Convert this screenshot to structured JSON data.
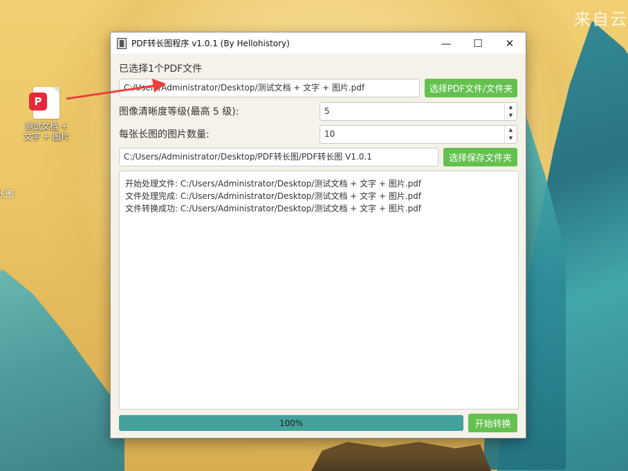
{
  "desktop": {
    "watermark": "来自云",
    "icon_label": "测试文档 +\n文字 + 图片",
    "icon_badge": "P",
    "left_edge_label": "长图"
  },
  "window": {
    "title": "PDF转长图程序 v1.0.1 (By Hellohistory)",
    "controls": {
      "minimize": "—",
      "maximize": "☐",
      "close": "✕"
    },
    "selected_count_label": "已选择1个PDF文件",
    "pdf_path": "C:/Users/Administrator/Desktop/测试文档 + 文字 + 图片.pdf",
    "select_pdf_button": "选择PDF文件/文件夹",
    "clarity_label": "图像清晰度等级(最高 5 级):",
    "clarity_value": "5",
    "images_per_long_label": "每张长图的图片数量:",
    "images_per_long_value": "10",
    "save_path": "C:/Users/Administrator/Desktop/PDF转长图/PDF转长图 V1.0.1",
    "select_save_button": "选择保存文件夹",
    "log_lines": [
      "开始处理文件: C:/Users/Administrator/Desktop/测试文档 + 文字 + 图片.pdf",
      "文件处理完成: C:/Users/Administrator/Desktop/测试文档 + 文字 + 图片.pdf",
      "文件转换成功: C:/Users/Administrator/Desktop/测试文档 + 文字 + 图片.pdf"
    ],
    "progress_text": "100%",
    "progress_value": 100,
    "start_button": "开始转换"
  },
  "colors": {
    "accent_green": "#64c04f",
    "progress_teal": "#45a19c",
    "annotation_arrow": "#e8403a"
  }
}
